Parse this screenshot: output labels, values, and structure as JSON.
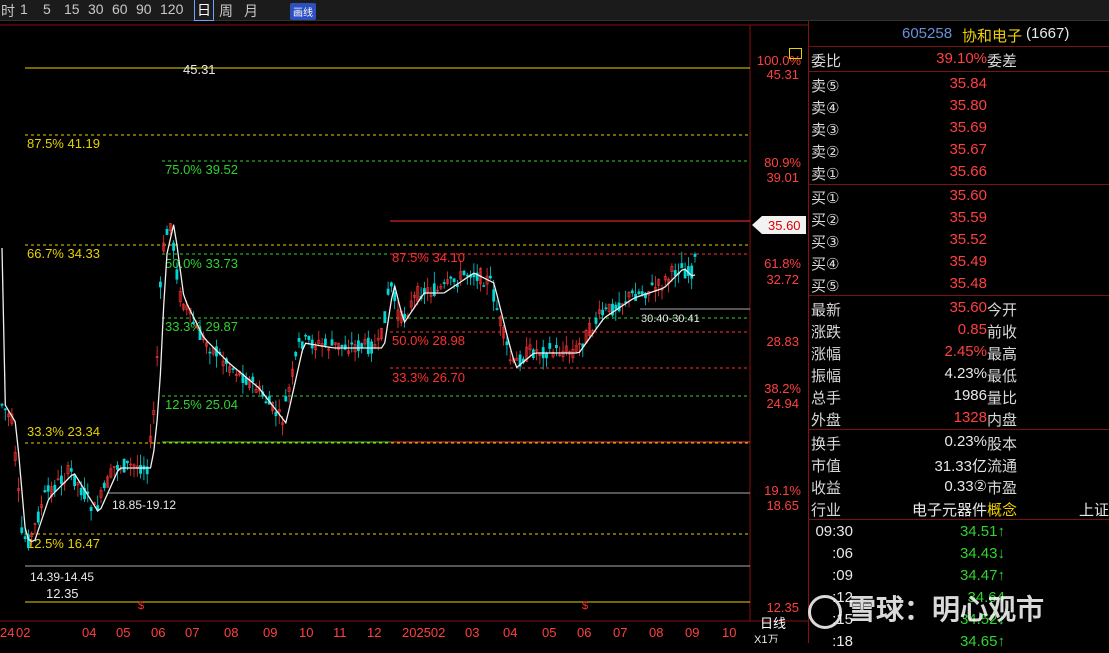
{
  "toolbar": {
    "items": [
      "时",
      "1",
      "5",
      "15",
      "30",
      "60",
      "90",
      "120",
      "日",
      "周",
      "月"
    ],
    "active": "日",
    "draw_button": "画线"
  },
  "stock": {
    "code": "605258",
    "name": "协和电子",
    "count": "(1667)"
  },
  "price_tag": "35.60",
  "fib_left": [
    {
      "label": "87.5% 41.19"
    },
    {
      "label": "66.7% 34.33"
    },
    {
      "label": "33.3% 23.34"
    },
    {
      "label": "12.5% 16.47"
    }
  ],
  "fib_mid": [
    {
      "label": "75.0% 39.52"
    },
    {
      "label": "50.0% 33.73"
    },
    {
      "label": "33.3% 29.87"
    },
    {
      "label": "12.5% 25.04"
    }
  ],
  "fib_right": [
    {
      "label": "87.5% 34.10"
    },
    {
      "label": "50.0% 28.98"
    },
    {
      "label": "33.3% 26.70"
    }
  ],
  "price_labels": {
    "high": "45.31",
    "range_1": "18.85-19.12",
    "range_2": "14.39-14.45",
    "low": "12.35",
    "range_3": "30.40-30.41"
  },
  "right_axis": [
    {
      "text": "100.0%"
    },
    {
      "text": "45.31"
    },
    {
      "text": "80.9%"
    },
    {
      "text": "39.01"
    },
    {
      "text": "61.8%"
    },
    {
      "text": "32.72"
    },
    {
      "text": "28.83"
    },
    {
      "text": "38.2%"
    },
    {
      "text": "24.94"
    },
    {
      "text": "19.1%"
    },
    {
      "text": "18.65"
    },
    {
      "text": "12.35"
    }
  ],
  "x_axis": [
    {
      "text": "24"
    },
    {
      "text": "02"
    },
    {
      "text": "04"
    },
    {
      "text": "05"
    },
    {
      "text": "06"
    },
    {
      "text": "07"
    },
    {
      "text": "08"
    },
    {
      "text": "09"
    },
    {
      "text": "10"
    },
    {
      "text": "11"
    },
    {
      "text": "12"
    },
    {
      "text": "202502"
    },
    {
      "text": "03"
    },
    {
      "text": "04"
    },
    {
      "text": "05"
    },
    {
      "text": "06"
    },
    {
      "text": "07"
    },
    {
      "text": "08"
    },
    {
      "text": "09"
    },
    {
      "text": "10"
    }
  ],
  "period_label": "日线",
  "period_sub": "X1万",
  "quote": {
    "weibi": {
      "label": "委比",
      "value": "39.10%",
      "label2": "委差"
    },
    "sell": [
      {
        "label": "卖⑤",
        "value": "35.84"
      },
      {
        "label": "卖④",
        "value": "35.80"
      },
      {
        "label": "卖③",
        "value": "35.69"
      },
      {
        "label": "卖②",
        "value": "35.67"
      },
      {
        "label": "卖①",
        "value": "35.66"
      }
    ],
    "buy": [
      {
        "label": "买①",
        "value": "35.60"
      },
      {
        "label": "买②",
        "value": "35.59"
      },
      {
        "label": "买③",
        "value": "35.52"
      },
      {
        "label": "买④",
        "value": "35.49"
      },
      {
        "label": "买⑤",
        "value": "35.48"
      }
    ],
    "stats": [
      {
        "label": "最新",
        "value": "35.60",
        "label2": "今开",
        "color": "red"
      },
      {
        "label": "涨跌",
        "value": "0.85",
        "label2": "前收",
        "color": "red"
      },
      {
        "label": "涨幅",
        "value": "2.45%",
        "label2": "最高",
        "color": "red"
      },
      {
        "label": "振幅",
        "value": "4.23%",
        "label2": "最低",
        "color": "white"
      },
      {
        "label": "总手",
        "value": "1986",
        "label2": "量比",
        "color": "white"
      },
      {
        "label": "外盘",
        "value": "1328",
        "label2": "内盘",
        "color": "red"
      }
    ],
    "info": [
      {
        "label": "换手",
        "value": "0.23%",
        "label2": "股本"
      },
      {
        "label": "市值",
        "value": "31.33亿",
        "label2": "流通"
      },
      {
        "label": "收益",
        "value": "0.33②",
        "label2": "市盈"
      }
    ],
    "industry": {
      "label": "行业",
      "value": "电子元器件",
      "label2": "概念",
      "extra": "上证"
    }
  },
  "ticks": [
    {
      "time": "09:30",
      "price": "34.51↑",
      "color": "green"
    },
    {
      "time": ":06",
      "price": "34.43↓",
      "color": "green"
    },
    {
      "time": ":09",
      "price": "34.47↑",
      "color": "green"
    },
    {
      "time": ":12",
      "price": "34.64",
      "color": "green"
    },
    {
      "time": ":15",
      "price": "34.52↓",
      "color": "green"
    },
    {
      "time": ":18",
      "price": "34.65↑",
      "color": "green"
    }
  ],
  "watermark": "雪球：明心观市",
  "colors": {
    "up": "#ff3333",
    "down": "#00d8d8",
    "fib": "#e6d200",
    "green": "#2fd32f",
    "axis": "#ff4040"
  }
}
